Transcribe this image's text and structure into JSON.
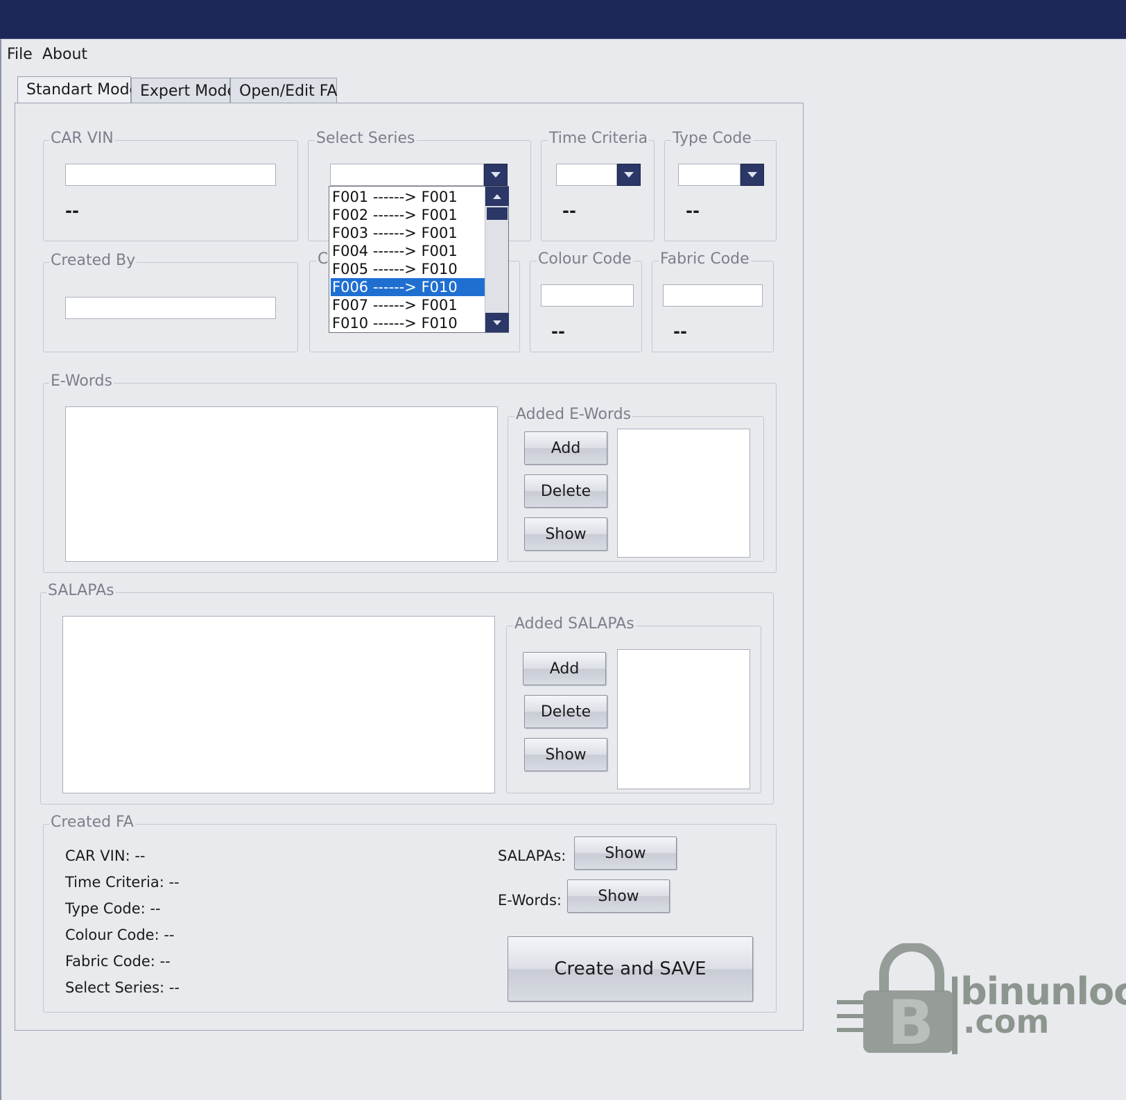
{
  "menu": {
    "file": "File",
    "about": "About"
  },
  "tabs": [
    {
      "label": "Standart Mode",
      "active": true
    },
    {
      "label": "Expert Mode",
      "active": false
    },
    {
      "label": "Open/Edit FA",
      "active": false
    }
  ],
  "groups": {
    "car_vin": {
      "legend": "CAR VIN",
      "value_text": "--"
    },
    "select_series": {
      "legend": "Select Series"
    },
    "time_criteria": {
      "legend": "Time Criteria",
      "value_text": "--"
    },
    "type_code": {
      "legend": "Type Code",
      "value_text": "--"
    },
    "created_by": {
      "legend": "Created By"
    },
    "hidden_group": {
      "legend_partial": "C"
    },
    "colour_code": {
      "legend": "Colour Code",
      "value_text": "--"
    },
    "fabric_code": {
      "legend": "Fabric Code",
      "value_text": "--"
    },
    "e_words": {
      "legend": "E-Words"
    },
    "added_e_words": {
      "legend": "Added E-Words",
      "add": "Add",
      "delete": "Delete",
      "show": "Show"
    },
    "salapas": {
      "legend": "SALAPAs"
    },
    "added_salapas": {
      "legend": "Added SALAPAs",
      "add": "Add",
      "delete": "Delete",
      "show": "Show"
    }
  },
  "series_dropdown": {
    "items": [
      "F001 ------> F001",
      "F002 ------> F001",
      "F003 ------> F001",
      "F004 ------> F001",
      "F005 ------> F010",
      "F006 ------> F010",
      "F007 ------> F001",
      "F010 ------> F010"
    ],
    "selected_index": 5
  },
  "created_fa": {
    "legend": "Created FA",
    "car_vin": "CAR VIN:  --",
    "time_criteria": "Time Criteria:  --",
    "type_code": "Type Code:  --",
    "colour_code": "Colour Code:  --",
    "fabric_code": "Fabric Code:  --",
    "select_series": "Select Series:  --",
    "salapas_label": "SALAPAs:",
    "salapas_show": "Show",
    "ewords_label": "E-Words:",
    "ewords_show": "Show",
    "create_save": "Create and SAVE"
  },
  "watermark": {
    "text_line1": "binunlock",
    "text_line2": ".com"
  },
  "colors": {
    "titlebar": "#1e2858",
    "selection": "#1f6fd1",
    "combo_button": "#2b3766"
  }
}
